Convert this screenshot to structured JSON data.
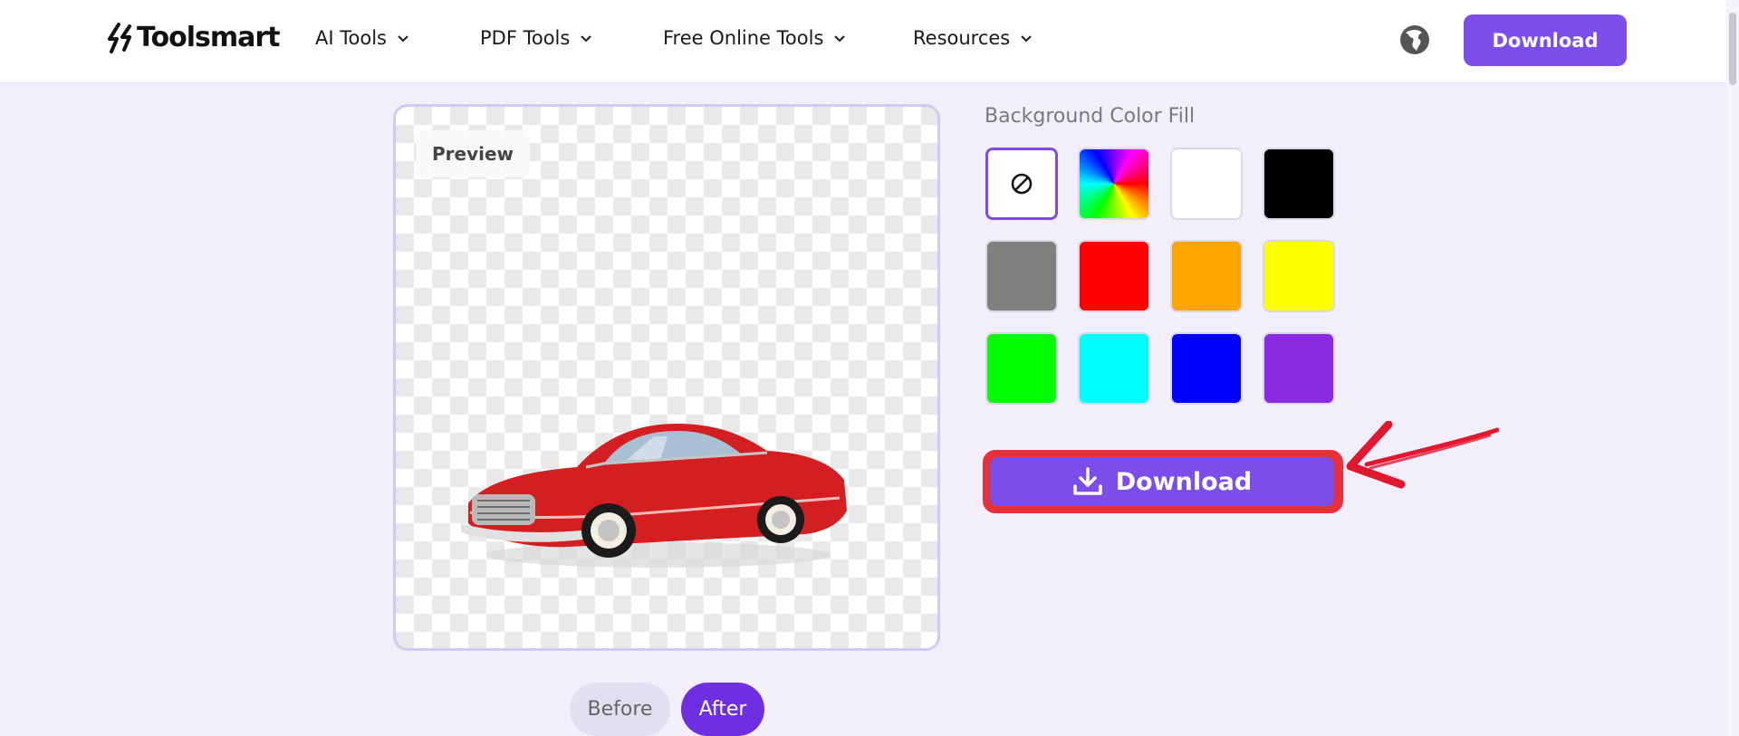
{
  "header": {
    "logo_text": "Toolsmart",
    "nav": [
      {
        "label": "AI Tools"
      },
      {
        "label": "PDF Tools"
      },
      {
        "label": "Free Online Tools"
      },
      {
        "label": "Resources"
      }
    ],
    "download_label": "Download"
  },
  "preview": {
    "badge": "Preview",
    "toggle_before": "Before",
    "toggle_after": "After"
  },
  "background_fill": {
    "title": "Background Color Fill",
    "swatches": [
      {
        "name": "none",
        "color": "#ffffff",
        "icon": "no-fill-icon"
      },
      {
        "name": "rainbow",
        "color": "conic"
      },
      {
        "name": "white",
        "color": "#ffffff"
      },
      {
        "name": "black",
        "color": "#000000"
      },
      {
        "name": "gray",
        "color": "#808080"
      },
      {
        "name": "red",
        "color": "#ff0000"
      },
      {
        "name": "orange",
        "color": "#ffa500"
      },
      {
        "name": "yellow",
        "color": "#ffff00"
      },
      {
        "name": "green",
        "color": "#00ff00"
      },
      {
        "name": "cyan",
        "color": "#00ffff"
      },
      {
        "name": "blue",
        "color": "#0000ff"
      },
      {
        "name": "purple",
        "color": "#8a2be2"
      }
    ]
  },
  "download_button": {
    "label": "Download",
    "icon": "download-icon"
  },
  "colors": {
    "accent": "#7c4dea",
    "highlight": "#e8303b",
    "page_bg": "#f2eefc"
  }
}
